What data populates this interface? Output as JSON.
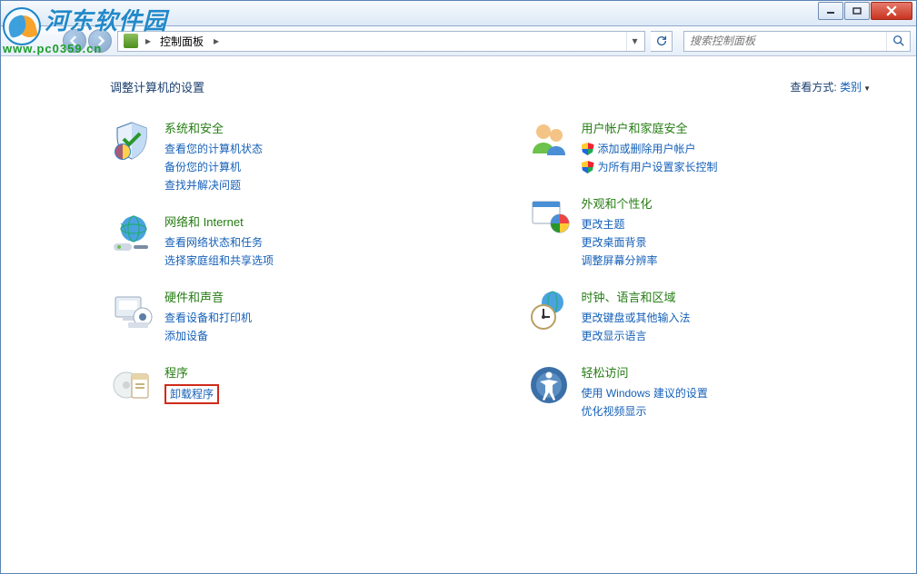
{
  "watermark": {
    "text": "河东软件园",
    "url": "www.pc0359.cn"
  },
  "breadcrumb": {
    "root": "控制面板"
  },
  "search": {
    "placeholder": "搜索控制面板"
  },
  "heading": "调整计算机的设置",
  "view_by": {
    "label": "查看方式:",
    "value": "类别"
  },
  "left": [
    {
      "title": "系统和安全",
      "links": [
        {
          "text": "查看您的计算机状态",
          "shield": false
        },
        {
          "text": "备份您的计算机",
          "shield": false
        },
        {
          "text": "查找并解决问题",
          "shield": false
        }
      ]
    },
    {
      "title": "网络和 Internet",
      "links": [
        {
          "text": "查看网络状态和任务",
          "shield": false
        },
        {
          "text": "选择家庭组和共享选项",
          "shield": false
        }
      ]
    },
    {
      "title": "硬件和声音",
      "links": [
        {
          "text": "查看设备和打印机",
          "shield": false
        },
        {
          "text": "添加设备",
          "shield": false
        }
      ]
    },
    {
      "title": "程序",
      "links": [
        {
          "text": "卸载程序",
          "shield": false,
          "highlight": true
        }
      ]
    }
  ],
  "right": [
    {
      "title": "用户帐户和家庭安全",
      "links": [
        {
          "text": "添加或删除用户帐户",
          "shield": true
        },
        {
          "text": "为所有用户设置家长控制",
          "shield": true
        }
      ]
    },
    {
      "title": "外观和个性化",
      "links": [
        {
          "text": "更改主题",
          "shield": false
        },
        {
          "text": "更改桌面背景",
          "shield": false
        },
        {
          "text": "调整屏幕分辨率",
          "shield": false
        }
      ]
    },
    {
      "title": "时钟、语言和区域",
      "links": [
        {
          "text": "更改键盘或其他输入法",
          "shield": false
        },
        {
          "text": "更改显示语言",
          "shield": false
        }
      ]
    },
    {
      "title": "轻松访问",
      "links": [
        {
          "text": "使用 Windows 建议的设置",
          "shield": false
        },
        {
          "text": "优化视频显示",
          "shield": false
        }
      ]
    }
  ]
}
